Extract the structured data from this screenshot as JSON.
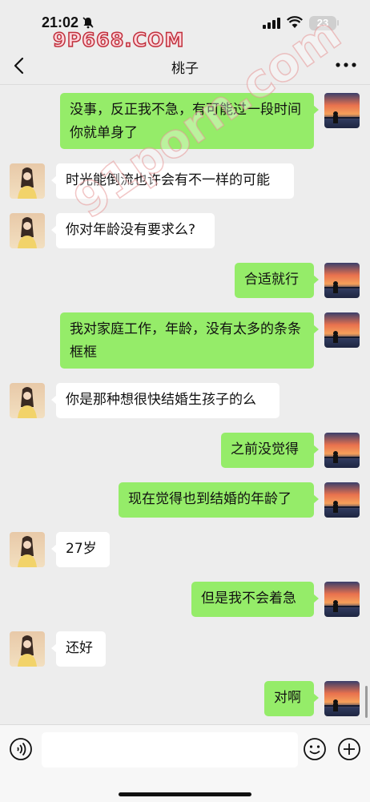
{
  "status": {
    "time": "21:02",
    "battery": "23"
  },
  "watermark": {
    "top": "9P668.COM",
    "diagonal": "91porn.com"
  },
  "chat": {
    "title": "桃子"
  },
  "messages": [
    {
      "side": "right",
      "text": "没事，反正我不急，有可能过一段时间你就单身了"
    },
    {
      "side": "left",
      "text": "时光能倒流也许会有不一样的可能"
    },
    {
      "side": "left",
      "text": "你对年龄没有要求么?"
    },
    {
      "side": "right",
      "text": "合适就行"
    },
    {
      "side": "right",
      "text": "我对家庭工作，年龄，没有太多的条条框框"
    },
    {
      "side": "left",
      "text": "你是那种想很快结婚生孩子的么"
    },
    {
      "side": "right",
      "text": "之前没觉得"
    },
    {
      "side": "right",
      "text": "现在觉得也到结婚的年龄了"
    },
    {
      "side": "left",
      "text": "27岁"
    },
    {
      "side": "right",
      "text": "但是我不会着急"
    },
    {
      "side": "left",
      "text": "还好"
    },
    {
      "side": "right",
      "text": "对啊"
    }
  ],
  "input": {
    "value": ""
  },
  "colors": {
    "background": "#ededed",
    "sent_bubble": "#95ec69",
    "received_bubble": "#ffffff"
  },
  "icons": {
    "back": "chevron-left-icon",
    "more": "more-dots-icon",
    "voice": "voice-icon",
    "emoji": "emoji-icon",
    "plus": "plus-icon"
  }
}
